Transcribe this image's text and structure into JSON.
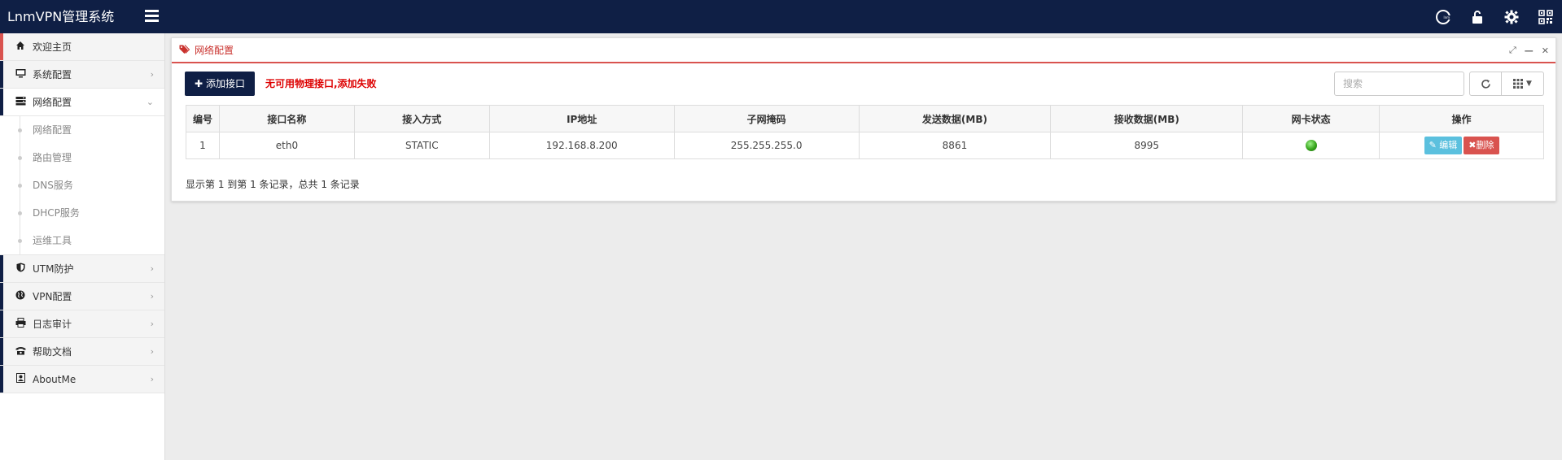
{
  "app": {
    "title": "LnmVPN管理系统"
  },
  "header": {
    "icons": [
      "lnm-logo-icon",
      "unlock-icon",
      "gear-icon",
      "qrcode-icon"
    ]
  },
  "sidebar": {
    "items": [
      {
        "label": "欢迎主页",
        "icon": "home-icon"
      },
      {
        "label": "系统配置",
        "icon": "monitor-icon"
      },
      {
        "label": "网络配置",
        "icon": "server-icon"
      },
      {
        "label": "UTM防护",
        "icon": "shield-icon"
      },
      {
        "label": "VPN配置",
        "icon": "globe-icon"
      },
      {
        "label": "日志审计",
        "icon": "print-icon"
      },
      {
        "label": "帮助文档",
        "icon": "phone-icon"
      },
      {
        "label": "AboutMe",
        "icon": "contact-icon"
      }
    ],
    "submenu": [
      {
        "label": "网络配置"
      },
      {
        "label": "路由管理"
      },
      {
        "label": "DNS服务"
      },
      {
        "label": "DHCP服务"
      },
      {
        "label": "运维工具"
      }
    ]
  },
  "panel": {
    "title": "网络配置",
    "add_button": "添加接口",
    "error_message": "无可用物理接口,添加失败",
    "search_placeholder": "搜索",
    "table": {
      "headers": [
        "编号",
        "接口名称",
        "接入方式",
        "IP地址",
        "子网掩码",
        "发送数据(MB)",
        "接收数据(MB)",
        "网卡状态",
        "操作"
      ],
      "rows": [
        {
          "id": "1",
          "name": "eth0",
          "mode": "STATIC",
          "ip": "192.168.8.200",
          "mask": "255.255.255.0",
          "sent": "8861",
          "recv": "8995",
          "status": "online",
          "edit": "编辑",
          "delete": "删除"
        }
      ]
    },
    "pagination_text": "显示第 1 到第 1 条记录，总共 1 条记录"
  },
  "colors": {
    "header_bg": "#0f1f45",
    "accent_red": "#d9534f",
    "edit_btn": "#5bc0de",
    "status_green": "#37a51d"
  }
}
